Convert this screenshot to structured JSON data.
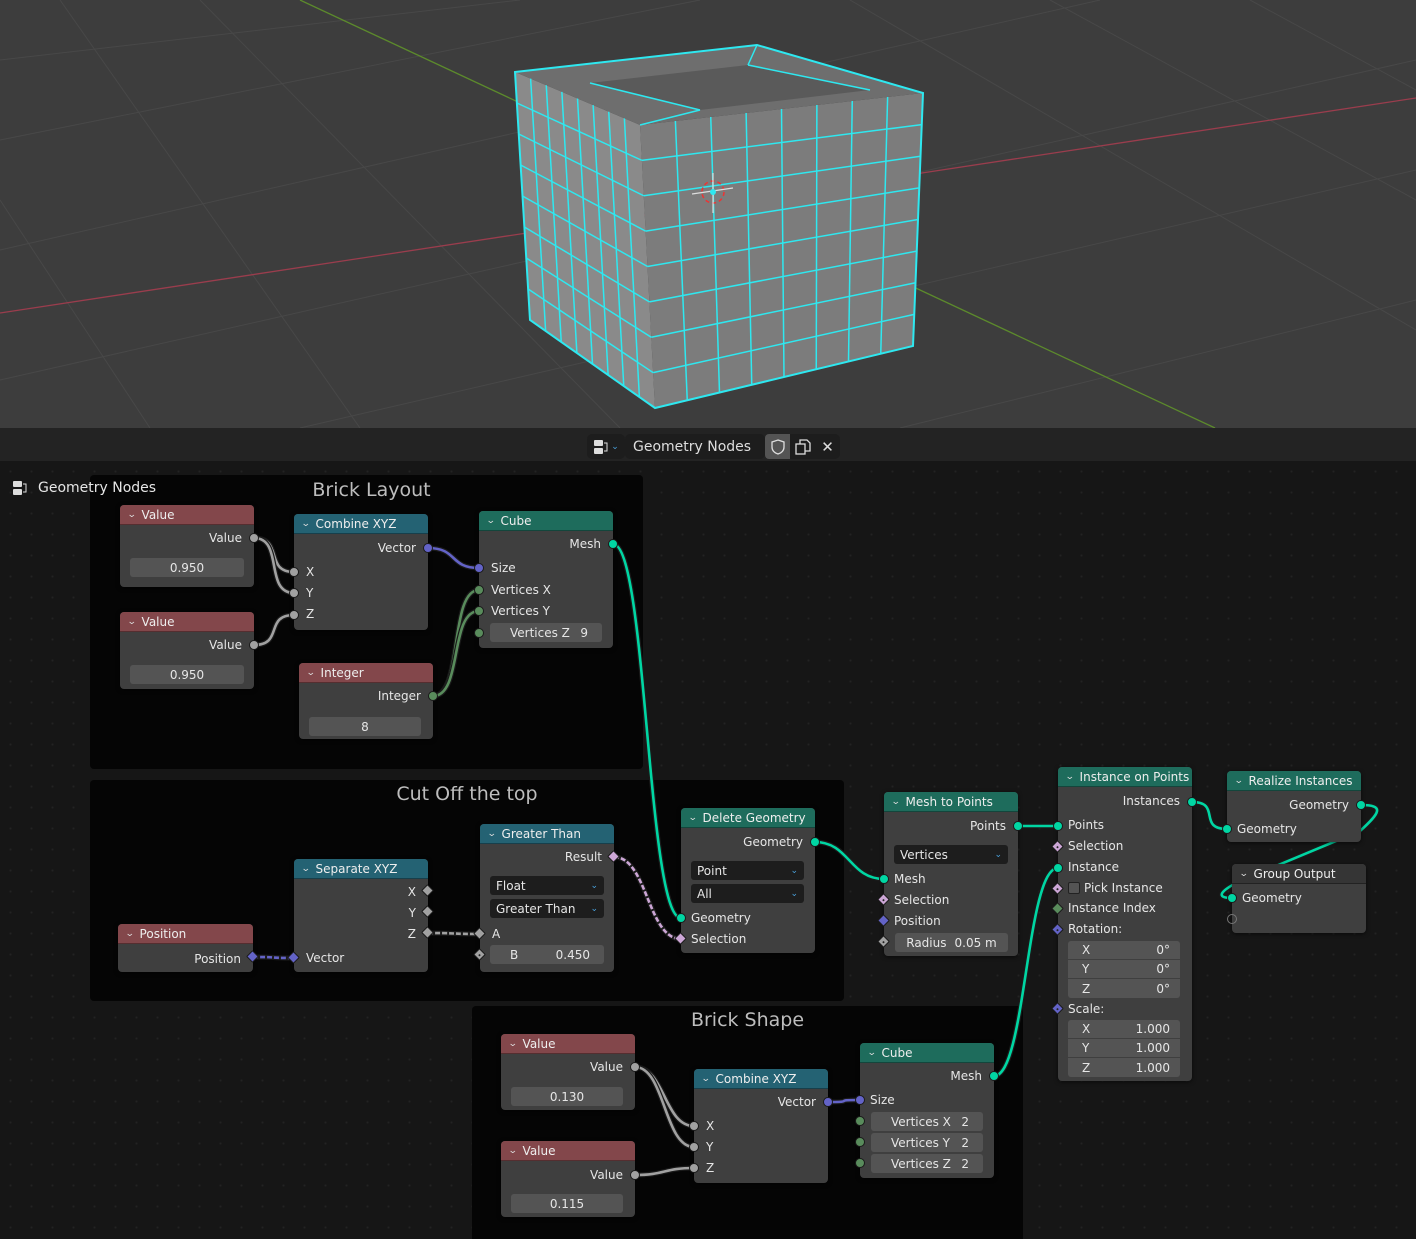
{
  "header": {
    "editor_type_icon": "node-editor-icon",
    "tree_name": "Geometry Nodes",
    "fake_user_icon": "shield-icon",
    "duplicate_icon": "duplicate-icon",
    "unlink_icon": "close-icon",
    "pin_icon": "pin-icon"
  },
  "breadcrumb": {
    "label": "Geometry Nodes"
  },
  "frames": {
    "brick_layout": "Brick Layout",
    "cut_off": "Cut Off the top",
    "brick_shape": "Brick Shape"
  },
  "nodes": {
    "value1": {
      "title": "Value",
      "out": "Value",
      "value": "0.950"
    },
    "value2": {
      "title": "Value",
      "out": "Value",
      "value": "0.950"
    },
    "combine1": {
      "title": "Combine XYZ",
      "out": "Vector",
      "x": "X",
      "y": "Y",
      "z": "Z"
    },
    "integer": {
      "title": "Integer",
      "out": "Integer",
      "value": "8"
    },
    "cube1": {
      "title": "Cube",
      "out": "Mesh",
      "size": "Size",
      "vx": "Vertices X",
      "vy": "Vertices Y",
      "vz_label": "Vertices Z",
      "vz_value": "9"
    },
    "position": {
      "title": "Position",
      "out": "Position"
    },
    "separate": {
      "title": "Separate XYZ",
      "x": "X",
      "y": "Y",
      "z": "Z",
      "in": "Vector"
    },
    "greater": {
      "title": "Greater Than",
      "out": "Result",
      "type": "Float",
      "op": "Greater Than",
      "a": "A",
      "b_label": "B",
      "b_value": "0.450"
    },
    "delete": {
      "title": "Delete Geometry",
      "out": "Geometry",
      "domain": "Point",
      "mode": "All",
      "geo": "Geometry",
      "sel": "Selection"
    },
    "m2p": {
      "title": "Mesh to Points",
      "out": "Points",
      "mode": "Vertices",
      "mesh": "Mesh",
      "sel": "Selection",
      "pos": "Position",
      "radius_label": "Radius",
      "radius_value": "0.05 m"
    },
    "iop": {
      "title": "Instance on Points",
      "out": "Instances",
      "points": "Points",
      "sel": "Selection",
      "inst": "Instance",
      "pick": "Pick Instance",
      "idx": "Instance Index",
      "rot": "Rotation:",
      "rot_vals": [
        {
          "axis": "X",
          "value": "0°"
        },
        {
          "axis": "Y",
          "value": "0°"
        },
        {
          "axis": "Z",
          "value": "0°"
        }
      ],
      "scale": "Scale:",
      "scale_vals": [
        {
          "axis": "X",
          "value": "1.000"
        },
        {
          "axis": "Y",
          "value": "1.000"
        },
        {
          "axis": "Z",
          "value": "1.000"
        }
      ]
    },
    "realize": {
      "title": "Realize Instances",
      "out": "Geometry",
      "in": "Geometry"
    },
    "group_out": {
      "title": "Group Output",
      "in": "Geometry"
    },
    "value3": {
      "title": "Value",
      "out": "Value",
      "value": "0.130"
    },
    "value4": {
      "title": "Value",
      "out": "Value",
      "value": "0.115"
    },
    "combine2": {
      "title": "Combine XYZ",
      "out": "Vector",
      "x": "X",
      "y": "Y",
      "z": "Z"
    },
    "cube2": {
      "title": "Cube",
      "out": "Mesh",
      "size": "Size",
      "vx_label": "Vertices X",
      "vx_value": "2",
      "vy_label": "Vertices Y",
      "vy_value": "2",
      "vz_label": "Vertices Z",
      "vz_value": "2"
    }
  },
  "colors": {
    "geometry": "#00d6a3",
    "vector": "#6363c7",
    "float": "#a1a1a1",
    "integer": "#598c5c",
    "boolean": "#cca6d6",
    "selection_outline": "#2ee8f0"
  }
}
